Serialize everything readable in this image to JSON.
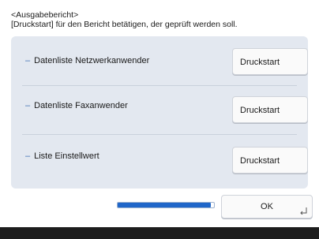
{
  "header": {
    "title": "<Ausgabebericht>",
    "instruction": "[Druckstart] für den Bericht betätigen, der geprüft werden soll."
  },
  "rows": [
    {
      "label": "Datenliste Netzwerkanwender",
      "button": "Druckstart"
    },
    {
      "label": "Datenliste Faxanwender",
      "button": "Druckstart"
    },
    {
      "label": "Liste Einstellwert",
      "button": "Druckstart"
    }
  ],
  "bullet": "–",
  "progress": {
    "fraction": 0.97
  },
  "ok_button": "OK",
  "colors": {
    "panel": "#e3e8f0",
    "accent": "#1f66c9",
    "footer": "#1d1d1d"
  }
}
